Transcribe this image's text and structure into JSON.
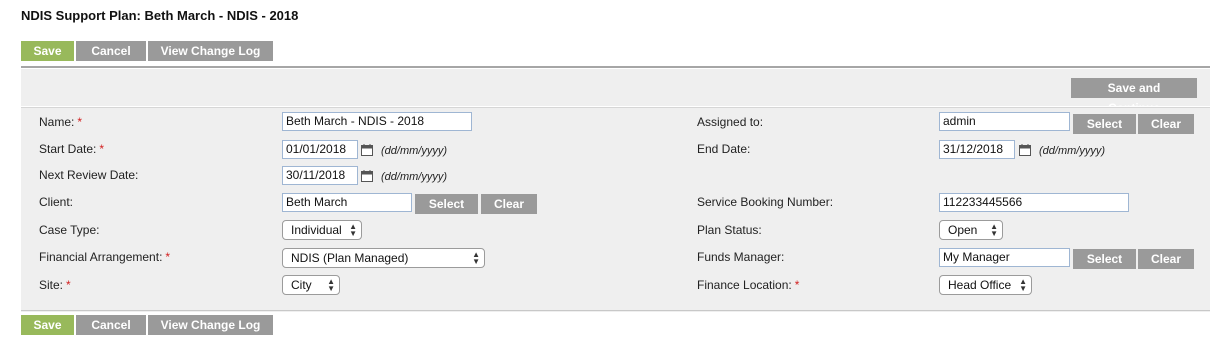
{
  "page": {
    "title": "NDIS Support Plan: Beth March - NDIS - 2018"
  },
  "toolbar": {
    "save": "Save",
    "cancel": "Cancel",
    "change_log": "View Change Log"
  },
  "save_continue": "Save and Continue",
  "colors": {
    "save_button": "#98b95b",
    "grey_button": "#9a9a9a",
    "required": "#d21f1f",
    "panel": "#efefef"
  },
  "form": {
    "date_format": "(dd/mm/yyyy)",
    "select_label": "Select",
    "clear_label": "Clear",
    "name": {
      "label": "Name:",
      "value": "Beth March - NDIS - 2018",
      "required": "*"
    },
    "start_date": {
      "label": "Start Date:",
      "value": "01/01/2018",
      "required": "*"
    },
    "next_review_date": {
      "label": "Next Review Date:",
      "value": "30/11/2018"
    },
    "client": {
      "label": "Client:",
      "value": "Beth March"
    },
    "case_type": {
      "label": "Case Type:",
      "value": "Individual"
    },
    "financial_arrangement": {
      "label": "Financial Arrangement:",
      "value": "NDIS (Plan Managed)",
      "required": "*"
    },
    "site": {
      "label": "Site:",
      "value": "City",
      "required": "*"
    },
    "assigned_to": {
      "label": "Assigned to:",
      "value": "admin"
    },
    "end_date": {
      "label": "End Date:",
      "value": "31/12/2018"
    },
    "service_booking_number": {
      "label": "Service Booking Number:",
      "value": "112233445566"
    },
    "plan_status": {
      "label": "Plan Status:",
      "value": "Open"
    },
    "funds_manager": {
      "label": "Funds Manager:",
      "value": "My Manager"
    },
    "finance_location": {
      "label": "Finance Location:",
      "value": "Head Office",
      "required": "*"
    }
  },
  "icons": {
    "calendar": "calendar-icon",
    "select_arrows": "updown-arrows-icon"
  }
}
